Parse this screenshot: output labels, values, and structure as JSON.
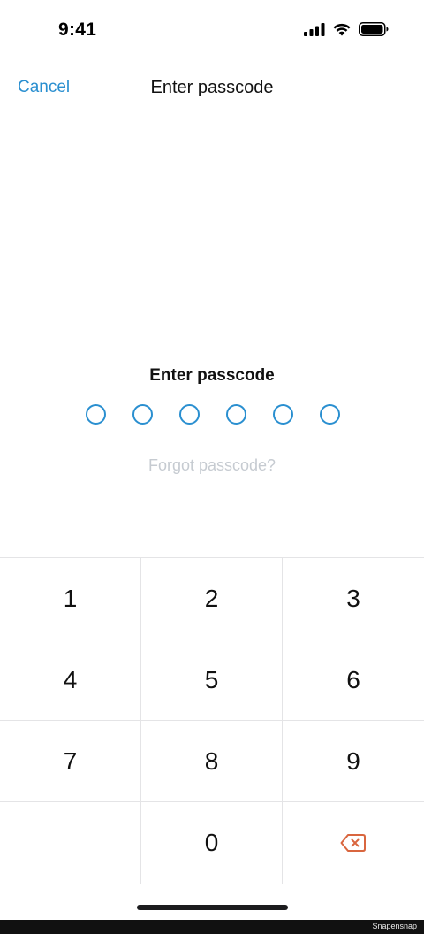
{
  "status": {
    "time": "9:41",
    "icons": [
      "cellular-signal-icon",
      "wifi-icon",
      "battery-icon"
    ]
  },
  "nav": {
    "cancel_label": "Cancel",
    "title": "Enter passcode"
  },
  "passcode": {
    "prompt": "Enter passcode",
    "digits_total": 6,
    "digits_entered": 0,
    "forgot_label": "Forgot passcode?"
  },
  "keypad": {
    "keys": [
      "1",
      "2",
      "3",
      "4",
      "5",
      "6",
      "7",
      "8",
      "9",
      "",
      "0",
      "delete"
    ],
    "delete_icon": "backspace-icon"
  },
  "colors": {
    "accent": "#2a8fd0",
    "delete": "#d9663f",
    "muted_link": "#c6cbd1"
  },
  "watermark": "Snapensnap"
}
